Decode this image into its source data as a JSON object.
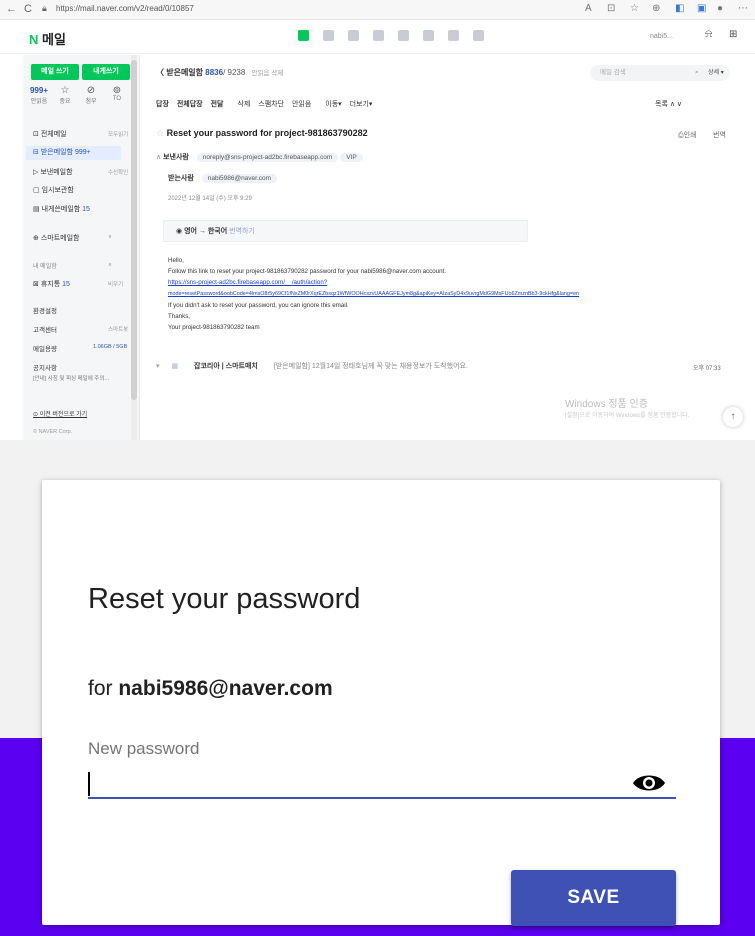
{
  "browser": {
    "url": "https://mail.naver.com/v2/read/0/10857",
    "nav": {
      "back": "←",
      "refresh": "C"
    }
  },
  "naver": {
    "logo_n": "N",
    "logo_text": "메일",
    "user": "nabi5...",
    "sidebar": {
      "write_button": "메일 쓰기",
      "self_button": "내게쓰기",
      "stats": [
        {
          "value": "999+",
          "label": "안읽음"
        },
        {
          "icon": "star-icon",
          "glyph": "☆",
          "label": "중요"
        },
        {
          "icon": "clip-icon",
          "glyph": "⊘",
          "label": "첨부"
        },
        {
          "icon": "tome-icon",
          "glyph": "⊚",
          "label": "TO"
        }
      ],
      "items": [
        {
          "label": "전체메일",
          "hint": "모두읽기"
        },
        {
          "label": "받은메일함",
          "count": "999+"
        },
        {
          "label": "보낸메일함",
          "hint": "수신확인"
        },
        {
          "label": "임시보관함"
        },
        {
          "label": "내게쓴메일함",
          "count": "15"
        },
        {
          "label": "스마트메일함"
        },
        {
          "label": "내 메일함"
        },
        {
          "label": "휴지통",
          "count": "15",
          "hint": "비우기"
        },
        {
          "label": "환경설정"
        },
        {
          "label": "고객센터",
          "hint": "스마트봇"
        },
        {
          "label": "메일용량",
          "hint": "1.06GB / 5GB"
        },
        {
          "label": "공지사항"
        },
        {
          "label": "[안내] 사칭 및 피싱 메일에 주의..."
        },
        {
          "label": "이전 버전으로 가기"
        },
        {
          "label": "© NAVER Corp."
        }
      ]
    },
    "mail": {
      "folder": "〈 받은메일함",
      "count_unread": "8836",
      "count_total": "/ 9238",
      "folder_action": "안읽음 삭제",
      "search_placeholder": "메일 검색",
      "search_option": "상세 ▾",
      "toolbar": [
        "답장",
        "전체답장",
        "전달",
        "삭제",
        "스팸차단",
        "안읽음",
        "이동▾",
        "더보기▾"
      ],
      "toolbar_right": "목록  ∧  ∨",
      "subject": "Reset your password for project-981863790282",
      "print": "인쇄",
      "translate": "번역",
      "from_label": "보낸사람",
      "from": "noreply@sns-project-ad2bc.firebaseapp.com",
      "vip": "VIP",
      "to_label": "받는사람",
      "to": "nabi5986@naver.com",
      "date": "2022년 12월 14일 (수) 오후 9:29",
      "trans_lang": "영어 → 한국어",
      "trans_link": "번역하기",
      "body": [
        "Hello,",
        "Follow this link to reset your project-981863790282 password for your nabi5986@naver.com account.",
        "https://sns-project-ad2bc.firebaseapp.com/__/auth/action?",
        "mode=resetPassword&oobCode=4lmsO8r5y69Cf1fNxZM0rXqrEZbsqz1WfWOOHcszvUAAAGFEJym8g&apiKey=AIzaSyD4x9uvrgMdG9MsFUo6ZmznBb3-9ckHfg&lang=en",
        "If you didn't ask to reset your password, you can ignore this email.",
        "Thanks,",
        "Your project-981863790282 team"
      ],
      "next_sender": "잡코리아 | 스마트매치",
      "next_subject": "[받은메일함] 12월14일 정태호님께 꼭 맞는 채용정보가 도착했어요.",
      "next_time": "오후 07:33",
      "windows_title": "Windows 정품 인증",
      "windows_sub": "[설정]으로 이동하여 Windows를 정품 인증합니다."
    }
  },
  "reset": {
    "title": "Reset your password",
    "for_prefix": "for",
    "email": "nabi5986@naver.com",
    "field_label": "New password",
    "field_value": "",
    "toggle_icon": "eye-icon",
    "save_label": "SAVE",
    "colors": {
      "accent": "#3f51b5",
      "backdrop": "#5b00f0"
    }
  }
}
